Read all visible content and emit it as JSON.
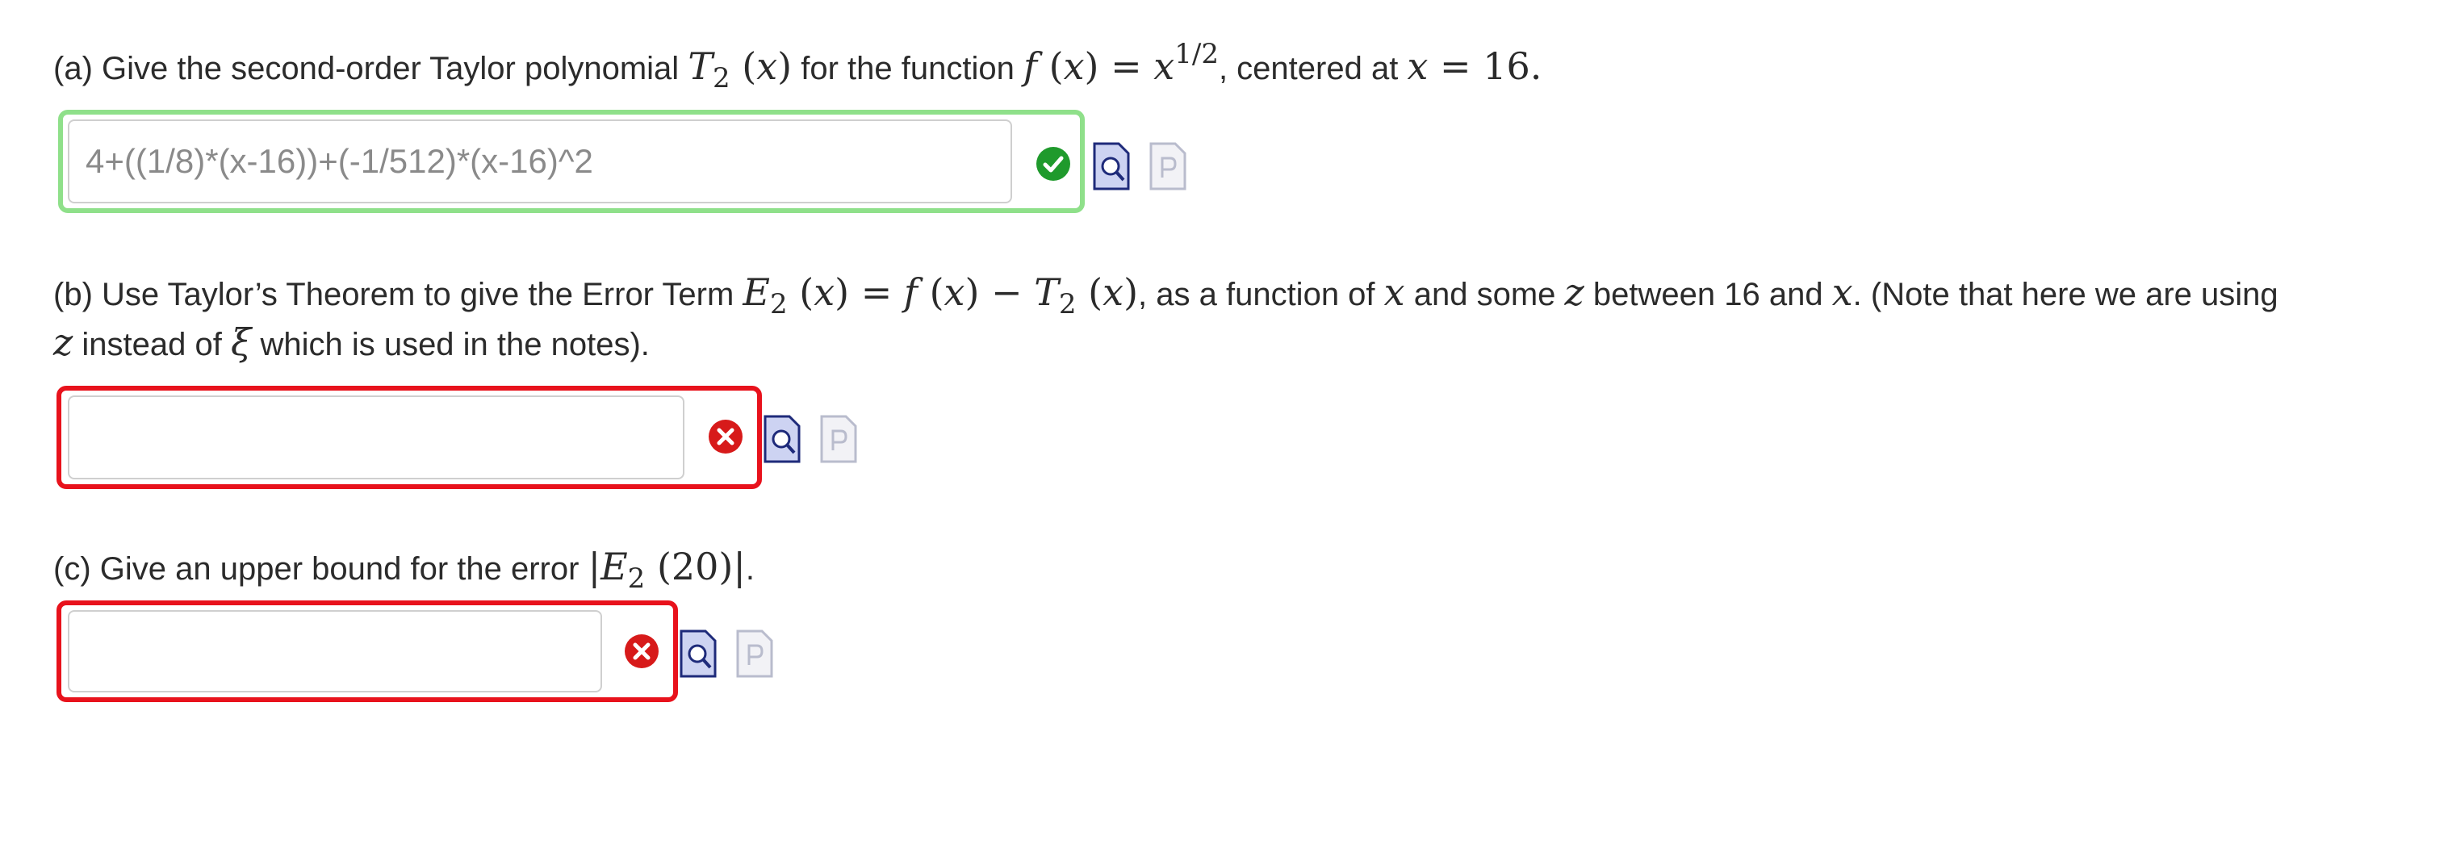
{
  "part_a": {
    "prefix": "(a) Give the second-order Taylor polynomial",
    "middle": "for the function",
    "suffix": ", centered at",
    "answer_value": "4+((1/8)*(x-16))+(-1/512)*(x-16)^2",
    "status": "correct",
    "status_color": "#1f9a2c",
    "frame_color": "#8fe08a"
  },
  "part_b": {
    "prefix": "(b) Use Taylor’s Theorem to give the Error Term",
    "line1_mid1": ", as a function of",
    "line1_mid2": "and some",
    "line1_mid3": "between 16 and",
    "line1_end": ". (Note that here we are using",
    "line2_mid": "instead of",
    "line2_end": "which is used in the notes).",
    "answer_value": "",
    "status": "incorrect",
    "status_color": "#d71a1a",
    "frame_color": "#e8121c"
  },
  "part_c": {
    "prefix": "(c) Give an upper bound for the error",
    "suffix": ".",
    "answer_value": "",
    "status": "incorrect",
    "status_color": "#d71a1a",
    "frame_color": "#e8121c"
  },
  "icons": {
    "correct": "check-circle-icon",
    "incorrect": "x-circle-icon",
    "preview": "preview-magnifier-icon",
    "preview_disabled": "disabled-p-document-icon"
  }
}
